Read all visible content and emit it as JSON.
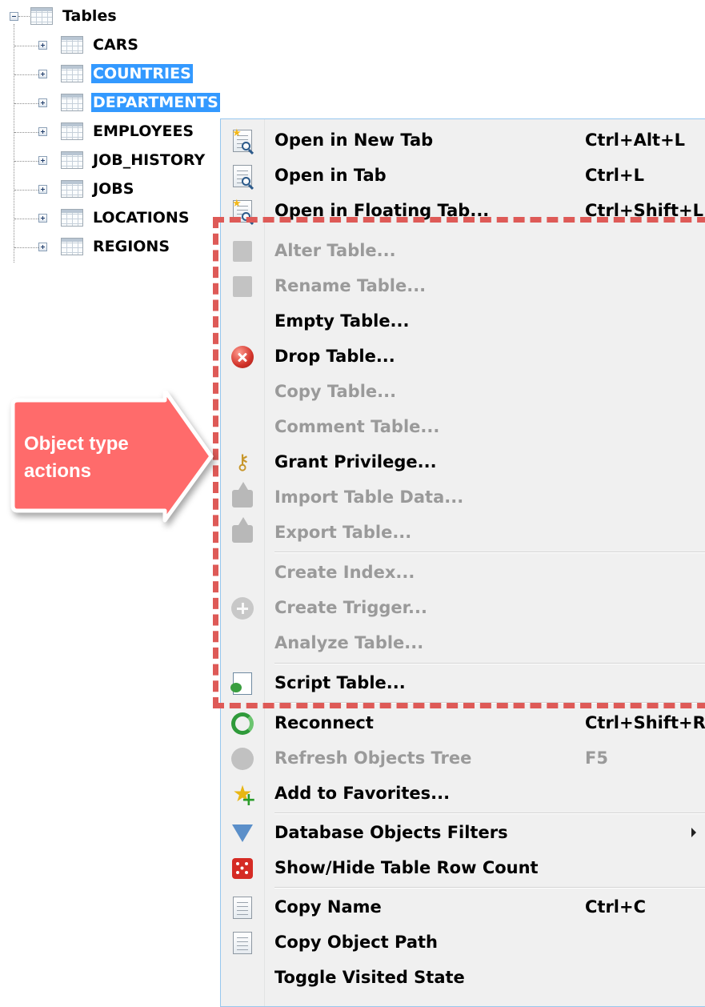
{
  "tree": {
    "root_label": "Tables",
    "children": [
      {
        "label": "CARS",
        "selected": false
      },
      {
        "label": "COUNTRIES",
        "selected": true
      },
      {
        "label": "DEPARTMENTS",
        "selected": true
      },
      {
        "label": "EMPLOYEES",
        "selected": false
      },
      {
        "label": "JOB_HISTORY",
        "selected": false
      },
      {
        "label": "JOBS",
        "selected": false
      },
      {
        "label": "LOCATIONS",
        "selected": false
      },
      {
        "label": "REGIONS",
        "selected": false
      }
    ]
  },
  "menu": {
    "items": [
      {
        "label": "Open in New Tab",
        "shortcut": "Ctrl+Alt+L",
        "enabled": true,
        "icon": "open-new-tab-icon"
      },
      {
        "label": "Open in Tab",
        "shortcut": "Ctrl+L",
        "enabled": true,
        "icon": "open-tab-icon"
      },
      {
        "label": "Open in Floating Tab...",
        "shortcut": "Ctrl+Shift+L",
        "enabled": true,
        "icon": "open-floating-tab-icon"
      },
      {
        "label": "Alter Table...",
        "shortcut": "",
        "enabled": false,
        "icon": "alter-table-icon"
      },
      {
        "label": "Rename Table...",
        "shortcut": "",
        "enabled": false,
        "icon": "rename-table-icon"
      },
      {
        "label": "Empty Table...",
        "shortcut": "",
        "enabled": true,
        "icon": ""
      },
      {
        "label": "Drop Table...",
        "shortcut": "",
        "enabled": true,
        "icon": "drop-table-icon"
      },
      {
        "label": "Copy Table...",
        "shortcut": "",
        "enabled": false,
        "icon": ""
      },
      {
        "label": "Comment Table...",
        "shortcut": "",
        "enabled": false,
        "icon": ""
      },
      {
        "label": "Grant Privilege...",
        "shortcut": "",
        "enabled": true,
        "icon": "key-icon"
      },
      {
        "label": "Import Table Data...",
        "shortcut": "",
        "enabled": false,
        "icon": "import-icon"
      },
      {
        "label": "Export Table...",
        "shortcut": "",
        "enabled": false,
        "icon": "export-icon"
      },
      {
        "label": "Create Index...",
        "shortcut": "",
        "enabled": false,
        "icon": ""
      },
      {
        "label": "Create Trigger...",
        "shortcut": "",
        "enabled": false,
        "icon": "create-trigger-icon"
      },
      {
        "label": "Analyze Table...",
        "shortcut": "",
        "enabled": false,
        "icon": ""
      },
      {
        "label": "Script Table...",
        "shortcut": "",
        "enabled": true,
        "icon": "script-table-icon"
      },
      {
        "label": "Reconnect",
        "shortcut": "Ctrl+Shift+R",
        "enabled": true,
        "icon": "reconnect-icon"
      },
      {
        "label": "Refresh Objects Tree",
        "shortcut": "F5",
        "enabled": false,
        "icon": "refresh-icon"
      },
      {
        "label": "Add to Favorites...",
        "shortcut": "",
        "enabled": true,
        "icon": "add-favorites-icon"
      },
      {
        "label": "Database Objects Filters",
        "shortcut": "",
        "enabled": true,
        "icon": "filter-icon",
        "submenu": true
      },
      {
        "label": "Show/Hide Table Row Count",
        "shortcut": "",
        "enabled": true,
        "icon": "dice-icon"
      },
      {
        "label": "Copy Name",
        "shortcut": "Ctrl+C",
        "enabled": true,
        "icon": "copy-name-icon"
      },
      {
        "label": "Copy Object Path",
        "shortcut": "",
        "enabled": true,
        "icon": "copy-path-icon"
      },
      {
        "label": "Toggle Visited State",
        "shortcut": "",
        "enabled": true,
        "icon": ""
      }
    ]
  },
  "callout": {
    "text_line1": "Object type",
    "text_line2": "actions"
  },
  "colors": {
    "selection": "#3399ff",
    "annotation": "#de5a57",
    "callout_fill": "#ff6b6b"
  }
}
